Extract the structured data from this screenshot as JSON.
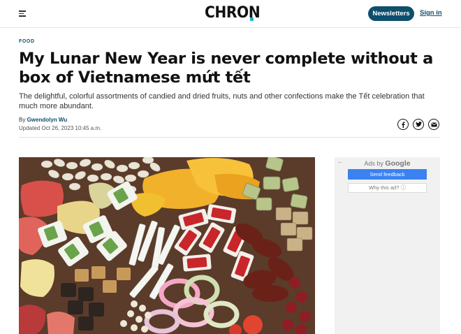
{
  "header": {
    "logo_text": "CHRON",
    "newsletters_label": "Newsletters",
    "signin_label": "Sign in",
    "brand_color": "#0d4f6c",
    "accent_color": "#1ab3c4",
    "menu_icon": "hamburger-icon"
  },
  "article": {
    "section": "FOOD",
    "headline": "My Lunar New Year is never complete without a box of Vietnamese mứt tết",
    "dek": "The delightful, colorful assortments of candied and dried fruits, nuts and other confections make the Tết celebration that much more abundant.",
    "by_prefix": "By",
    "author": "Gwendolyn Wu",
    "updated": "Updated Oct 26, 2023 10:45 a.m.",
    "share_icons": [
      "facebook-icon",
      "twitter-icon",
      "email-icon"
    ]
  },
  "ad": {
    "ads_by": "Ads by",
    "google": "Google",
    "send_feedback": "Send feedback",
    "why_this_ad": "Why this ad? ⓘ",
    "back_arrow": "←"
  }
}
